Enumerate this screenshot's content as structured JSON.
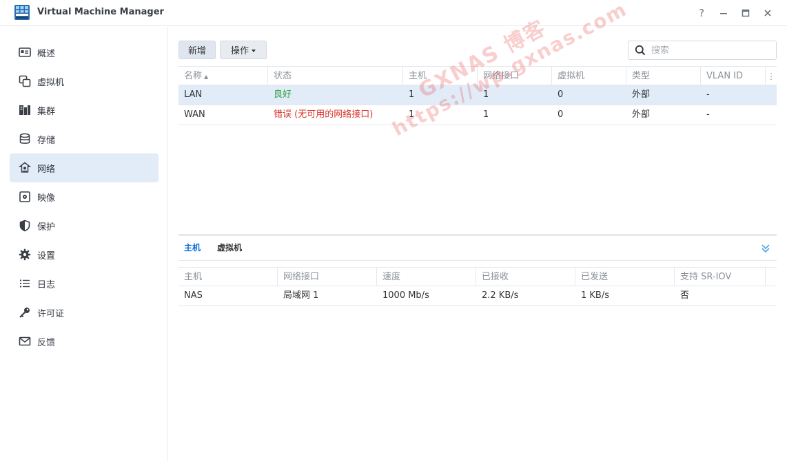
{
  "window": {
    "title": "Virtual Machine Manager",
    "help_label": "?"
  },
  "sidebar": {
    "items": [
      {
        "label": "概述",
        "icon": "overview-icon"
      },
      {
        "label": "虚拟机",
        "icon": "virtual-machine-icon"
      },
      {
        "label": "集群",
        "icon": "cluster-icon"
      },
      {
        "label": "存储",
        "icon": "storage-icon"
      },
      {
        "label": "网络",
        "icon": "network-icon",
        "active": true
      },
      {
        "label": "映像",
        "icon": "image-icon"
      },
      {
        "label": "保护",
        "icon": "shield-icon"
      },
      {
        "label": "设置",
        "icon": "gear-icon"
      },
      {
        "label": "日志",
        "icon": "list-icon"
      },
      {
        "label": "许可证",
        "icon": "key-icon"
      },
      {
        "label": "反馈",
        "icon": "mail-icon"
      }
    ]
  },
  "toolbar": {
    "new_label": "新增",
    "action_label": "操作",
    "search_placeholder": "搜索"
  },
  "networks": {
    "columns": [
      "名称",
      "状态",
      "主机",
      "网络接口",
      "虚拟机",
      "类型",
      "VLAN ID"
    ],
    "rows": [
      {
        "name": "LAN",
        "status": "良好",
        "status_color": "#2e9e3f",
        "hosts": "1",
        "interfaces": "1",
        "vms": "0",
        "type": "外部",
        "vlan": "-"
      },
      {
        "name": "WAN",
        "status": "错误 (无可用的网络接口)",
        "status_color": "#d9362b",
        "hosts": "1",
        "interfaces": "1",
        "vms": "0",
        "type": "外部",
        "vlan": "-"
      }
    ]
  },
  "detail": {
    "tabs": [
      "主机",
      "虚拟机"
    ],
    "columns": [
      "主机",
      "网络接口",
      "速度",
      "已接收",
      "已发送",
      "支持 SR-IOV"
    ],
    "rows": [
      {
        "host": "NAS",
        "interface": "局域网 1",
        "speed": "1000 Mb/s",
        "received": "2.2 KB/s",
        "sent": "1 KB/s",
        "sriov": "否"
      }
    ]
  },
  "watermark": {
    "line1": "GXNAS 博客",
    "line2": "https://wp.gxnas.com"
  },
  "colors": {
    "accent": "#0a6bd6",
    "selected_bg": "#e1ecf8",
    "ok": "#2e9e3f",
    "error": "#d9362b"
  }
}
